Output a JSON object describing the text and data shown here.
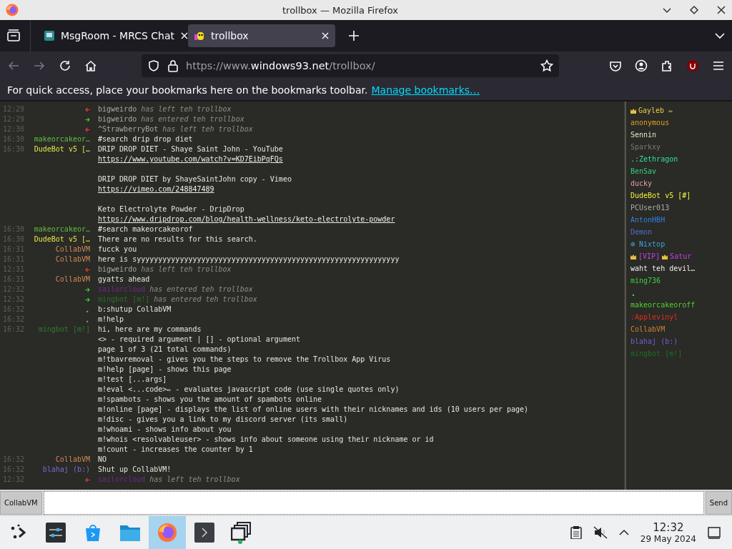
{
  "browser": {
    "title": "trollbox — Mozilla Firefox",
    "tabs": [
      {
        "label": "MsgRoom - MRCS Chat",
        "selected": false
      },
      {
        "label": "trollbox",
        "selected": true
      }
    ],
    "url": {
      "prefix": "https://www.",
      "domain": "windows93.net",
      "path": "/trollbox/"
    },
    "bookmarks_hint": "For quick access, place your bookmarks here on the bookmarks toolbar.",
    "bookmarks_link": "Manage bookmarks…"
  },
  "messages": [
    {
      "time": "12:29",
      "kind": "leave",
      "nick": "bigweirdo",
      "color": "#a8a8a8",
      "text": "has left teh trollbox"
    },
    {
      "time": "12:29",
      "kind": "join",
      "nick": "bigweirdo",
      "color": "#a8a8a8",
      "text": "has entered teh trollbox"
    },
    {
      "time": "12:30",
      "kind": "leave",
      "nick": "^StrawberryBot",
      "color": "#a8a8a8",
      "text": "has left teh trollbox"
    },
    {
      "time": "16:30",
      "kind": "message",
      "nick": "makeorcakeor…",
      "color": "#5fbf3f",
      "lines": [
        {
          "text": "#search drip drop diet"
        }
      ]
    },
    {
      "time": "16:30",
      "kind": "message",
      "nick": "DudeBot v5 […",
      "color": "#e6e645",
      "blocks": [
        {
          "lines": [
            {
              "text": "DRIP DROP DIET - Shaye Saint John - YouTube"
            },
            {
              "text": "https://www.youtube.com/watch?v=KD7EibPqFQs",
              "link": true
            }
          ]
        },
        {
          "lines": [
            {
              "text": "DRIP DROP DIET by ShayeSaintJohn copy - Vimeo"
            },
            {
              "text": "https://vimeo.com/248847489",
              "link": true
            }
          ]
        },
        {
          "lines": [
            {
              "text": "Keto Electrolyte Powder - DripDrop"
            },
            {
              "text": "https://www.dripdrop.com/blog/health-wellness/keto-electrolyte-powder",
              "link": true
            }
          ]
        }
      ]
    },
    {
      "time": "16:30",
      "kind": "message",
      "nick": "makeorcakeor…",
      "color": "#5fbf3f",
      "lines": [
        {
          "text": "#search makeorcakeorof"
        }
      ]
    },
    {
      "time": "16:30",
      "kind": "message",
      "nick": "DudeBot v5 […",
      "color": "#e6e645",
      "lines": [
        {
          "text": "There are no results for this search."
        }
      ]
    },
    {
      "time": "16:31",
      "kind": "message",
      "nick": "CollabVM",
      "color": "#d08a55",
      "lines": [
        {
          "text": "fucck you"
        }
      ]
    },
    {
      "time": "16:31",
      "kind": "message",
      "nick": "CollabVM",
      "color": "#d08a55",
      "lines": [
        {
          "text": "here is syyyyyyyyyyyyyyyyyyyyyyyyyyyyyyyyyyyyyyyyyyyyyyyyyyyyyyyyyyyyy"
        }
      ]
    },
    {
      "time": "12:31",
      "kind": "leave",
      "nick": "bigweirdo",
      "color": "#a8a8a8",
      "text": "has left teh trollbox"
    },
    {
      "time": "16:31",
      "kind": "message",
      "nick": "CollabVM",
      "color": "#d08a55",
      "lines": [
        {
          "text": "gyatts ahead"
        }
      ]
    },
    {
      "time": "12:32",
      "kind": "join",
      "nick": "sailorcloud",
      "color": "#6e2a8e",
      "text": "has entered teh trollbox"
    },
    {
      "time": "12:32",
      "kind": "join",
      "nick": "mingbot [m!]",
      "color": "#2a6e2a",
      "text": "has entered teh trollbox"
    },
    {
      "time": "16:32",
      "kind": "message",
      "nick": ".",
      "color": "#8a8a8a",
      "lines": [
        {
          "text": "b:shutup CollabVM"
        }
      ]
    },
    {
      "time": "16:32",
      "kind": "message",
      "nick": ".",
      "color": "#8a8a8a",
      "lines": [
        {
          "text": "m!help"
        }
      ]
    },
    {
      "time": "16:32",
      "kind": "message",
      "nick": "mingbot [m!]",
      "color": "#2e7d2e",
      "lines": [
        {
          "text": "hi, here are my commands"
        },
        {
          "text": "<> - required argument | [] - optional argument"
        },
        {
          "text": "page 1 of 3 (21 total commands)"
        },
        {
          "text": "m!tbavremoval - gives you the steps to remove the Trollbox App Virus"
        },
        {
          "text": "m!help [page] - shows this page"
        },
        {
          "text": "m!test [...args]"
        },
        {
          "text": "m!eval <...code>✏ - evaluates javascript code (use single quotes only)"
        },
        {
          "text": "m!spambots - shows you the amount of spambots online"
        },
        {
          "text": "m!online [page] - displays the list of online users with their nicknames and ids (10 users per page)"
        },
        {
          "text": "m!disc - gives you a link to my discord server (its small)"
        },
        {
          "text": "m!whoami - shows info about you"
        },
        {
          "text": "m!whois <resolvableuser> - shows info about someone using their nickname or id"
        },
        {
          "text": "m!count - increases the counter by 1"
        }
      ]
    },
    {
      "time": "16:32",
      "kind": "message",
      "nick": "CollabVM",
      "color": "#d08a55",
      "lines": [
        {
          "text": "NO"
        }
      ]
    },
    {
      "time": "16:32",
      "kind": "message",
      "nick": "blahaj (b:)",
      "color": "#7a6ad0",
      "lines": [
        {
          "text": "Shut up CollabVM!"
        }
      ]
    },
    {
      "time": "12:32",
      "kind": "leave",
      "nick": "sailorcloud",
      "color": "#6e2a8e",
      "text": "has left teh trollbox"
    }
  ],
  "users": [
    {
      "color": "#e8d048",
      "parts": [
        {
          "kind": "crown"
        },
        {
          "kind": "text",
          "text": "Gayleb ✏"
        }
      ]
    },
    {
      "color": "#e0a020",
      "parts": [
        {
          "kind": "text",
          "text": "anonymous"
        }
      ]
    },
    {
      "color": "#e8e8c8",
      "parts": [
        {
          "kind": "text",
          "text": "Sennin"
        }
      ]
    },
    {
      "color": "#777777",
      "parts": [
        {
          "kind": "text",
          "text": "Sparkxy"
        }
      ]
    },
    {
      "color": "#30e0a0",
      "parts": [
        {
          "kind": "text",
          "text": ".:Zethragon"
        }
      ]
    },
    {
      "color": "#30d080",
      "parts": [
        {
          "kind": "text",
          "text": "BenSav"
        }
      ]
    },
    {
      "color": "#e0a0a0",
      "parts": [
        {
          "kind": "text",
          "text": "ducky"
        }
      ]
    },
    {
      "color": "#f0f040",
      "parts": [
        {
          "kind": "text",
          "text": "DudeBot v5 [#]"
        }
      ]
    },
    {
      "color": "#aaaaaa",
      "parts": [
        {
          "kind": "text",
          "text": "PCUser013"
        }
      ]
    },
    {
      "color": "#3080e0",
      "parts": [
        {
          "kind": "text",
          "text": "AntonHBH"
        }
      ]
    },
    {
      "color": "#5070d0",
      "parts": [
        {
          "kind": "text",
          "text": "Demon"
        }
      ]
    },
    {
      "color": "#40a0e0",
      "parts": [
        {
          "kind": "text",
          "text": "❄ Nixtop"
        }
      ]
    },
    {
      "color": "#c040e0",
      "parts": [
        {
          "kind": "crown"
        },
        {
          "kind": "text",
          "text": "[VIP]"
        },
        {
          "kind": "crown"
        },
        {
          "kind": "text",
          "text": "Satur"
        }
      ]
    },
    {
      "color": "#f0f0f0",
      "parts": [
        {
          "kind": "text",
          "text": "waht teh devil…"
        }
      ]
    },
    {
      "color": "#40d040",
      "parts": [
        {
          "kind": "text",
          "text": "ming736"
        }
      ]
    },
    {
      "color": "#40d041",
      "parts": [
        {
          "kind": "text",
          "text": "."
        }
      ]
    },
    {
      "color": "#50d030",
      "parts": [
        {
          "kind": "text",
          "text": "makeorcakeoroff"
        }
      ]
    },
    {
      "color": "#e03020",
      "parts": [
        {
          "kind": "text",
          "text": ":Applevinyl"
        }
      ]
    },
    {
      "color": "#d08030",
      "parts": [
        {
          "kind": "text",
          "text": "CollabVM"
        }
      ]
    },
    {
      "color": "#7060d0",
      "parts": [
        {
          "kind": "text",
          "text": "blahaj (b:)"
        }
      ]
    },
    {
      "color": "#207020",
      "parts": [
        {
          "kind": "text",
          "text": "mingbot [m!]"
        }
      ]
    }
  ],
  "input": {
    "nick_button": "CollabVM",
    "send_button": "Send"
  },
  "taskbar": {
    "apps": [
      {
        "kind": "settings",
        "selected": false
      },
      {
        "kind": "store",
        "selected": false
      },
      {
        "kind": "files",
        "selected": false
      },
      {
        "kind": "browser",
        "selected": true
      },
      {
        "kind": "terminal",
        "selected": false
      },
      {
        "kind": "windows",
        "selected": false
      }
    ],
    "time": "12:32",
    "date": "29 May 2024"
  }
}
